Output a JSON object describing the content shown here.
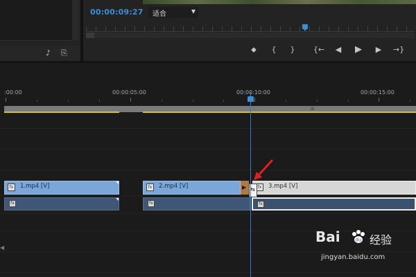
{
  "monitor": {
    "timecode": "00:00:09:27",
    "fit_value": "适合",
    "controls": {
      "marker": "⬥",
      "mark_in": "{",
      "mark_out": "}",
      "go_to_in": "{←",
      "step_back": "◀",
      "play": "▶",
      "step_forward": "▶",
      "go_to_out": "→}"
    }
  },
  "timeline": {
    "ruler_labels": [
      ":00:00",
      "00:00:05:00",
      "00:00:10:00",
      "00:00:15:00"
    ],
    "clips": [
      {
        "name": "1.mp4 [V]",
        "fx": "fx"
      },
      {
        "name": "2.mp4 [V]",
        "fx": "fx"
      },
      {
        "name": "3.mp4 [V]",
        "fx": "fx"
      }
    ],
    "audio_fx": "fx",
    "work_area_grip": "III"
  },
  "watermark": {
    "brand": "Bai",
    "brand_du": "du",
    "product": "经验",
    "url": "jingyan.baidu.com"
  },
  "colors": {
    "accent_blue": "#3a8fd8",
    "clip_blue": "#7aa6d8",
    "audio_blue": "#3f5676",
    "work_area_yellow": "#d8c227",
    "trim_orange": "#b27a43",
    "pointer_red": "#e02020"
  },
  "icons": {
    "project_a": "audio-note-icon",
    "project_b": "new-item-icon",
    "edge": "chevron-left-icon"
  }
}
